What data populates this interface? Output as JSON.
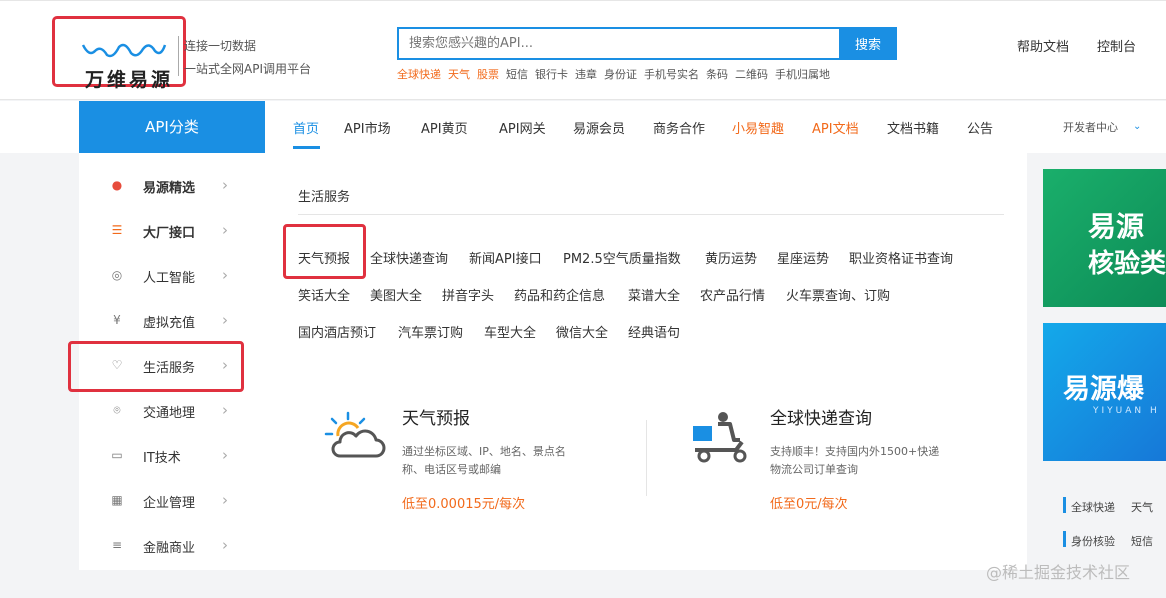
{
  "header": {
    "logo_text": "万维易源",
    "slogan_line1": "连接一切数据",
    "slogan_line2": "一站式全网API调用平台",
    "search_placeholder": "搜索您感兴趣的API...",
    "search_button": "搜索",
    "hot_words": [
      {
        "label": "全球快递",
        "highlight": true
      },
      {
        "label": "天气",
        "highlight": true
      },
      {
        "label": "股票",
        "highlight": true
      },
      {
        "label": "短信",
        "highlight": false
      },
      {
        "label": "银行卡",
        "highlight": false
      },
      {
        "label": "违章",
        "highlight": false
      },
      {
        "label": "身份证",
        "highlight": false
      },
      {
        "label": "手机号实名",
        "highlight": false
      },
      {
        "label": "条码",
        "highlight": false
      },
      {
        "label": "二维码",
        "highlight": false
      },
      {
        "label": "手机归属地",
        "highlight": false
      }
    ],
    "help_docs": "帮助文档",
    "console": "控制台"
  },
  "nav": {
    "category": "API分类",
    "items": [
      {
        "label": "首页",
        "style": "active"
      },
      {
        "label": "API市场",
        "style": "normal"
      },
      {
        "label": "API黄页",
        "style": "normal"
      },
      {
        "label": "API网关",
        "style": "normal"
      },
      {
        "label": "易源会员",
        "style": "normal"
      },
      {
        "label": "商务合作",
        "style": "normal"
      },
      {
        "label": "小易智趣",
        "style": "orange"
      },
      {
        "label": "API文档",
        "style": "orange"
      },
      {
        "label": "文档书籍",
        "style": "normal"
      },
      {
        "label": "公告",
        "style": "normal"
      }
    ],
    "dev_center": "开发者中心"
  },
  "sidebar": {
    "items": [
      {
        "label": "易源精选",
        "icon": "fire-icon",
        "glyph": "●",
        "bold": true
      },
      {
        "label": "大厂接口",
        "icon": "sliders-icon",
        "glyph": "☰",
        "bold": true
      },
      {
        "label": "人工智能",
        "icon": "ai-icon",
        "glyph": "◎",
        "bold": false
      },
      {
        "label": "虚拟充值",
        "icon": "yen-icon",
        "glyph": "¥",
        "bold": false
      },
      {
        "label": "生活服务",
        "icon": "heart-icon",
        "glyph": "♡",
        "bold": false
      },
      {
        "label": "交通地理",
        "icon": "location-icon",
        "glyph": "⌾",
        "bold": false
      },
      {
        "label": "IT技术",
        "icon": "monitor-icon",
        "glyph": "▭",
        "bold": false
      },
      {
        "label": "企业管理",
        "icon": "building-icon",
        "glyph": "▦",
        "bold": false
      },
      {
        "label": "金融商业",
        "icon": "coins-icon",
        "glyph": "≡",
        "bold": false
      }
    ]
  },
  "panel": {
    "title": "生活服务",
    "links_row1": [
      "天气预报",
      "全球快递查询",
      "新闻API接口",
      "PM2.5空气质量指数",
      "黄历运势",
      "星座运势",
      "职业资格证书查询"
    ],
    "links_row2": [
      "笑话大全",
      "美图大全",
      "拼音字头",
      "药品和药企信息",
      "菜谱大全",
      "农产品行情",
      "火车票查询、订购"
    ],
    "links_row3": [
      "国内酒店预订",
      "汽车票订购",
      "车型大全",
      "微信大全",
      "经典语句"
    ],
    "card1": {
      "title": "天气预报",
      "desc": "通过坐标区域、IP、地名、景点名称、电话区号或邮编",
      "price": "低至0.00015元/每次"
    },
    "card2": {
      "title": "全球快递查询",
      "desc": "支持顺丰！支持国内外1500+快递物流公司订单查询",
      "price": "低至0元/每次"
    }
  },
  "right": {
    "banner1_line1": "易源",
    "banner1_line2": "核验类",
    "banner2_line1": "易源爆",
    "banner2_sub": "YIYUAN H",
    "row1": [
      "全球快递",
      "天气"
    ],
    "row2": [
      "身份核验",
      "短信"
    ]
  },
  "watermark": "@稀土掘金技术社区"
}
